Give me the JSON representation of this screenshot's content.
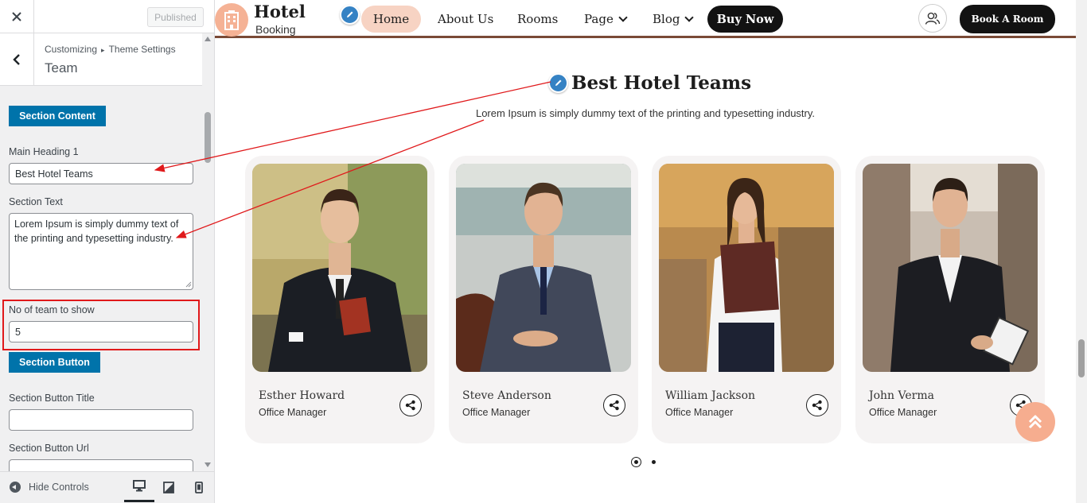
{
  "customizer": {
    "close_icon": "close-icon",
    "published_label": "Published",
    "breadcrumb": {
      "root": "Customizing",
      "separator": "▸",
      "parent": "Theme Settings"
    },
    "panel_title": "Team",
    "section_content_label": "Section Content",
    "main_heading_label": "Main Heading 1",
    "main_heading_value": "Best Hotel Teams",
    "section_text_label": "Section Text",
    "section_text_value": "Lorem Ipsum is simply dummy text of the printing and typesetting industry.",
    "team_count_label": "No of team to show",
    "team_count_value": "5",
    "section_button_label": "Section Button",
    "button_title_label": "Section Button Title",
    "button_title_value": "",
    "button_url_label": "Section Button Url",
    "button_url_value": "",
    "footer": {
      "hide_controls_label": "Hide Controls",
      "devices": [
        "desktop",
        "tablet",
        "mobile"
      ]
    }
  },
  "site": {
    "logo": {
      "title": "Hotel",
      "subtitle": "Booking",
      "icon": "hotel-building-icon"
    },
    "nav": [
      {
        "label": "Home",
        "active": true
      },
      {
        "label": "About Us"
      },
      {
        "label": "Rooms"
      },
      {
        "label": "Page",
        "dropdown": true
      },
      {
        "label": "Blog",
        "dropdown": true
      }
    ],
    "buy_now_label": "Buy Now",
    "book_room_label": "Book A Room",
    "user_icon": "user-group-icon"
  },
  "team_section": {
    "heading": "Best Hotel Teams",
    "text": "Lorem Ipsum is simply dummy text of the printing and typesetting industry.",
    "members": [
      {
        "name": "Esther Howard",
        "role": "Office Manager"
      },
      {
        "name": "Steve Anderson",
        "role": "Office Manager"
      },
      {
        "name": "William Jackson",
        "role": "Office Manager"
      },
      {
        "name": "John Verma",
        "role": "Office Manager"
      }
    ],
    "slider_pages": 2,
    "active_page": 1
  },
  "colors": {
    "wp_blue": "#0073aa",
    "accent_peach": "#f6ad8f",
    "nav_active_bg": "#f7d3c3",
    "header_border": "#7a4a36",
    "highlight_red": "#e0191b"
  }
}
